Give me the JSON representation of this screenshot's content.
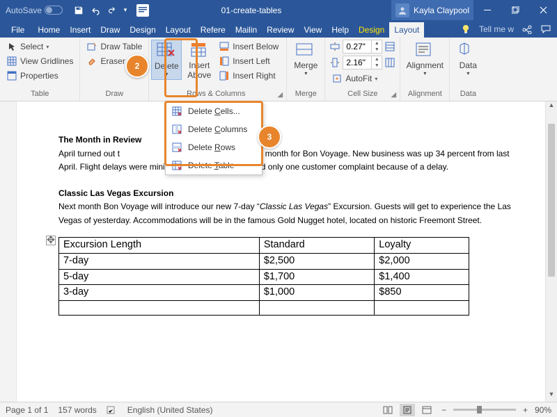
{
  "titlebar": {
    "autosave": "AutoSave",
    "docname": "01-create-tables",
    "username": "Kayla Claypool"
  },
  "tabs": {
    "file": "File",
    "list": [
      "Home",
      "Insert",
      "Draw",
      "Design",
      "Layout",
      "Refere",
      "Mailin",
      "Review",
      "View",
      "Help"
    ],
    "ctx": [
      "Design",
      "Layout"
    ],
    "tell": "Tell me w"
  },
  "ribbon": {
    "table": {
      "label": "Table",
      "select": "Select",
      "gridlines": "View Gridlines",
      "properties": "Properties"
    },
    "draw": {
      "label": "Draw",
      "drawtable": "Draw Table",
      "eraser": "Eraser"
    },
    "delete": {
      "btn": "Delete",
      "above": "Insert\nAbove",
      "below": "Insert Below",
      "left": "Insert Left",
      "right": "Insert Right"
    },
    "merge": {
      "label": "Merge",
      "btn": "Merge"
    },
    "cellsize": {
      "label": "Cell Size",
      "h": "0.27\"",
      "w": "2.16\"",
      "autofit": "AutoFit"
    },
    "rowscols_label": "Rows & Columns",
    "alignment": {
      "label": "Alignment",
      "btn": "Alignment"
    },
    "data": {
      "label": "Data",
      "btn": "Data"
    }
  },
  "dropdown": {
    "cells": "Delete Cells...",
    "columns": "Delete Columns",
    "rows": "Delete Rows",
    "table": "Delete Table",
    "u": {
      "cells": "C",
      "cols": "C",
      "rows": "R",
      "tbl": "T"
    }
  },
  "doc": {
    "h1": "The Month in Review",
    "p1a": "April turned out t",
    "p1b": "productive month for Bon Voyage. New business was up 34 percent from last April. Flight delays were minimal—Bon Voyage received only one customer complaint because of a delay.",
    "h2": "Classic Las Vegas Excursion",
    "p2a": "Next month Bon Voyage will introduce our new 7-day “",
    "p2i": "Classic Las Vegas",
    "p2b": "” Excursion. Guests will get to experience the Las Vegas of yesterday. Accommodations will be in the famous Gold Nugget hotel, located on historic Freemont Street.",
    "table": {
      "headers": [
        "Excursion Length",
        "Standard",
        "Loyalty"
      ],
      "rows": [
        [
          "7-day",
          "$2,500",
          "$2,000"
        ],
        [
          "5-day",
          "$1,700",
          "$1,400"
        ],
        [
          "3-day",
          "$1,000",
          "$850"
        ],
        [
          "",
          "",
          ""
        ]
      ]
    }
  },
  "status": {
    "page": "Page 1 of 1",
    "words": "157 words",
    "lang": "English (United States)",
    "zoom": "90%"
  },
  "badges": {
    "b2": "2",
    "b3": "3"
  }
}
